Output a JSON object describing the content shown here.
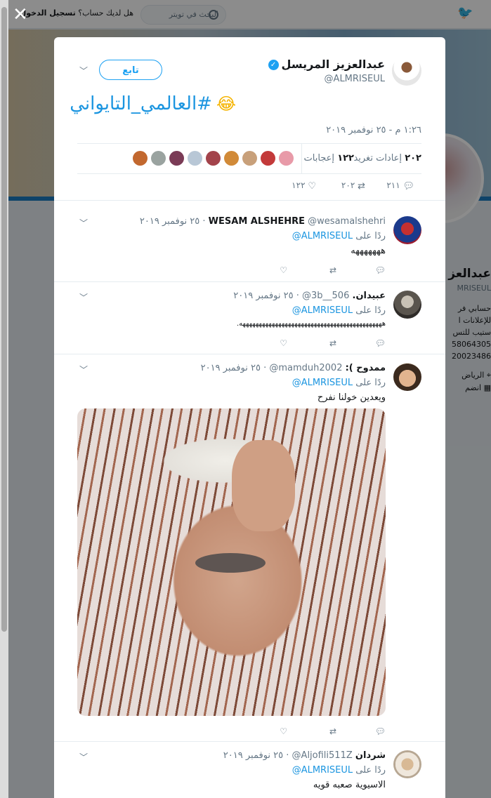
{
  "background": {
    "search_placeholder": "البحث في تويتر",
    "login_prompt": "هل لديك حساب؟",
    "login_label": "تسجيل الدخول",
    "side_name": "عبدالعز",
    "side_handle": "MRISEUL",
    "side_bio_1": "حسابي فر",
    "side_bio_2": "للإعلانات ا",
    "side_bio_3": "ستيب للتس",
    "side_phone_1": "58064305",
    "side_phone_2": "20023486",
    "side_location": "الرياض",
    "side_joined": "انضم"
  },
  "main_tweet": {
    "name": "عبدالعزيز المريسل",
    "handle": "@ALMRISEUL",
    "follow_label": "تابع",
    "text": "#العالمي_التايواني",
    "timestamp": "١:٢٦ م - ٢٥ نوفمبر ٢٠١٩",
    "retweets_count": "٢٠٢",
    "retweets_label": "إعادات تغريد",
    "likes_count": "١٢٢",
    "likes_label": "إعجابات",
    "actions": {
      "replies": "٢١١",
      "retweets": "٢٠٢",
      "likes": "١٢٢"
    }
  },
  "replies": [
    {
      "name": "WESAM ALSHEHRE",
      "handle": "@wesamalshehri",
      "date": "٢٥ نوفمبر ٢٠١٩",
      "replying_prefix": "ردًا على",
      "replying_to": "@ALMRISEUL",
      "text": "هههههههه"
    },
    {
      "name": "عبيدان.",
      "handle": "@3b__506",
      "date": "٢٥ نوفمبر ٢٠١٩",
      "replying_prefix": "ردًا على",
      "replying_to": "@ALMRISEUL",
      "text": "ههههههههههههههههههههههههههههههههههههههههههههه."
    },
    {
      "name": "ممدوح ):",
      "handle": "@mamduh2002",
      "date": "٢٥ نوفمبر ٢٠١٩",
      "replying_prefix": "ردًا على",
      "replying_to": "@ALMRISEUL",
      "text": "ويعدين خولنا نفرح"
    },
    {
      "name": "شردان",
      "handle": "@Aljofili511Z",
      "date": "٢٥ نوفمبر ٢٠١٩",
      "replying_prefix": "ردًا على",
      "replying_to": "@ALMRISEUL",
      "text": "الاسيوية صعبه قويه"
    }
  ],
  "colors": {
    "accent": "#1da1f2",
    "link": "#1b95e0",
    "text": "#14171a",
    "muted": "#657786"
  },
  "icons": {
    "close": "close-icon",
    "reply": "reply-icon",
    "retweet": "retweet-icon",
    "like": "heart-icon",
    "more": "chevron-down-icon",
    "verified": "verified-badge-icon",
    "emoji": "face-with-tears-of-joy"
  }
}
